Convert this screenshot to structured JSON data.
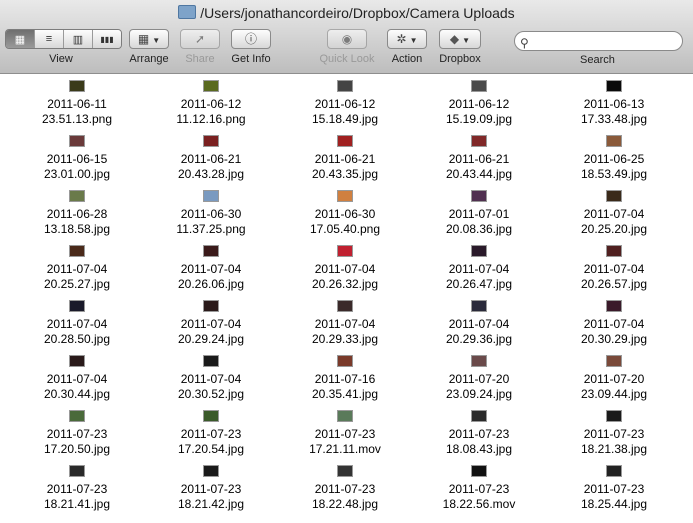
{
  "window": {
    "title": "/Users/jonathancordeiro/Dropbox/Camera Uploads"
  },
  "toolbar": {
    "view_label": "View",
    "arrange_label": "Arrange",
    "share_label": "Share",
    "getinfo_label": "Get Info",
    "quicklook_label": "Quick Look",
    "action_label": "Action",
    "dropbox_label": "Dropbox",
    "search_label": "Search",
    "search_placeholder": ""
  },
  "icons": {
    "view_icon": "▦",
    "list_icon": "≡",
    "columns_icon": "▥",
    "coverflow_icon": "▮▮▮",
    "arrange_icon": "▦",
    "share_icon": "➚",
    "getinfo_icon": "ⓘ",
    "quicklook_icon": "◉",
    "action_icon": "✲",
    "dropbox_icon": "◆",
    "search_icon": "⚲"
  },
  "files": [
    {
      "d": "2011-06-11",
      "t": "23.51.13.png",
      "c": "#3a3a1a"
    },
    {
      "d": "2011-06-12",
      "t": "11.12.16.png",
      "c": "#5a6a20"
    },
    {
      "d": "2011-06-12",
      "t": "15.18.49.jpg",
      "c": "#444444"
    },
    {
      "d": "2011-06-12",
      "t": "15.19.09.jpg",
      "c": "#4a4a4a"
    },
    {
      "d": "2011-06-13",
      "t": "17.33.48.jpg",
      "c": "#0a0a0a"
    },
    {
      "d": "2011-06-15",
      "t": "23.01.00.jpg",
      "c": "#6a3a3a"
    },
    {
      "d": "2011-06-21",
      "t": "20.43.28.jpg",
      "c": "#7a2020"
    },
    {
      "d": "2011-06-21",
      "t": "20.43.35.jpg",
      "c": "#a02020"
    },
    {
      "d": "2011-06-21",
      "t": "20.43.44.jpg",
      "c": "#802828"
    },
    {
      "d": "2011-06-25",
      "t": "18.53.49.jpg",
      "c": "#8a5a3a"
    },
    {
      "d": "2011-06-28",
      "t": "13.18.58.jpg",
      "c": "#6a7a4a"
    },
    {
      "d": "2011-06-30",
      "t": "11.37.25.png",
      "c": "#7a9ac0"
    },
    {
      "d": "2011-06-30",
      "t": "17.05.40.png",
      "c": "#d08040"
    },
    {
      "d": "2011-07-01",
      "t": "20.08.36.jpg",
      "c": "#503050"
    },
    {
      "d": "2011-07-04",
      "t": "20.25.20.jpg",
      "c": "#3a2a1a"
    },
    {
      "d": "2011-07-04",
      "t": "20.25.27.jpg",
      "c": "#4a2a1a"
    },
    {
      "d": "2011-07-04",
      "t": "20.26.06.jpg",
      "c": "#3a1a1a"
    },
    {
      "d": "2011-07-04",
      "t": "20.26.32.jpg",
      "c": "#c02030"
    },
    {
      "d": "2011-07-04",
      "t": "20.26.47.jpg",
      "c": "#2a1a2a"
    },
    {
      "d": "2011-07-04",
      "t": "20.26.57.jpg",
      "c": "#502020"
    },
    {
      "d": "2011-07-04",
      "t": "20.28.50.jpg",
      "c": "#1a1a2a"
    },
    {
      "d": "2011-07-04",
      "t": "20.29.24.jpg",
      "c": "#2a1a1a"
    },
    {
      "d": "2011-07-04",
      "t": "20.29.33.jpg",
      "c": "#3a2a2a"
    },
    {
      "d": "2011-07-04",
      "t": "20.29.36.jpg",
      "c": "#2a2a3a"
    },
    {
      "d": "2011-07-04",
      "t": "20.30.29.jpg",
      "c": "#3a1a2a"
    },
    {
      "d": "2011-07-04",
      "t": "20.30.44.jpg",
      "c": "#2a1a1a"
    },
    {
      "d": "2011-07-04",
      "t": "20.30.52.jpg",
      "c": "#1a1a1a"
    },
    {
      "d": "2011-07-16",
      "t": "20.35.41.jpg",
      "c": "#7a3a2a"
    },
    {
      "d": "2011-07-20",
      "t": "23.09.24.jpg",
      "c": "#6a4a4a"
    },
    {
      "d": "2011-07-20",
      "t": "23.09.44.jpg",
      "c": "#7a4a3a"
    },
    {
      "d": "2011-07-23",
      "t": "17.20.50.jpg",
      "c": "#4a6a3a"
    },
    {
      "d": "2011-07-23",
      "t": "17.20.54.jpg",
      "c": "#3a5a2a"
    },
    {
      "d": "2011-07-23",
      "t": "17.21.11.mov",
      "c": "#5a7a5a"
    },
    {
      "d": "2011-07-23",
      "t": "18.08.43.jpg",
      "c": "#2a2a2a"
    },
    {
      "d": "2011-07-23",
      "t": "18.21.38.jpg",
      "c": "#1a1a1a"
    },
    {
      "d": "2011-07-23",
      "t": "18.21.41.jpg",
      "c": "#2a2a2a"
    },
    {
      "d": "2011-07-23",
      "t": "18.21.42.jpg",
      "c": "#1a1a1a"
    },
    {
      "d": "2011-07-23",
      "t": "18.22.48.jpg",
      "c": "#333333"
    },
    {
      "d": "2011-07-23",
      "t": "18.22.56.mov",
      "c": "#111111"
    },
    {
      "d": "2011-07-23",
      "t": "18.25.44.jpg",
      "c": "#222222"
    }
  ]
}
